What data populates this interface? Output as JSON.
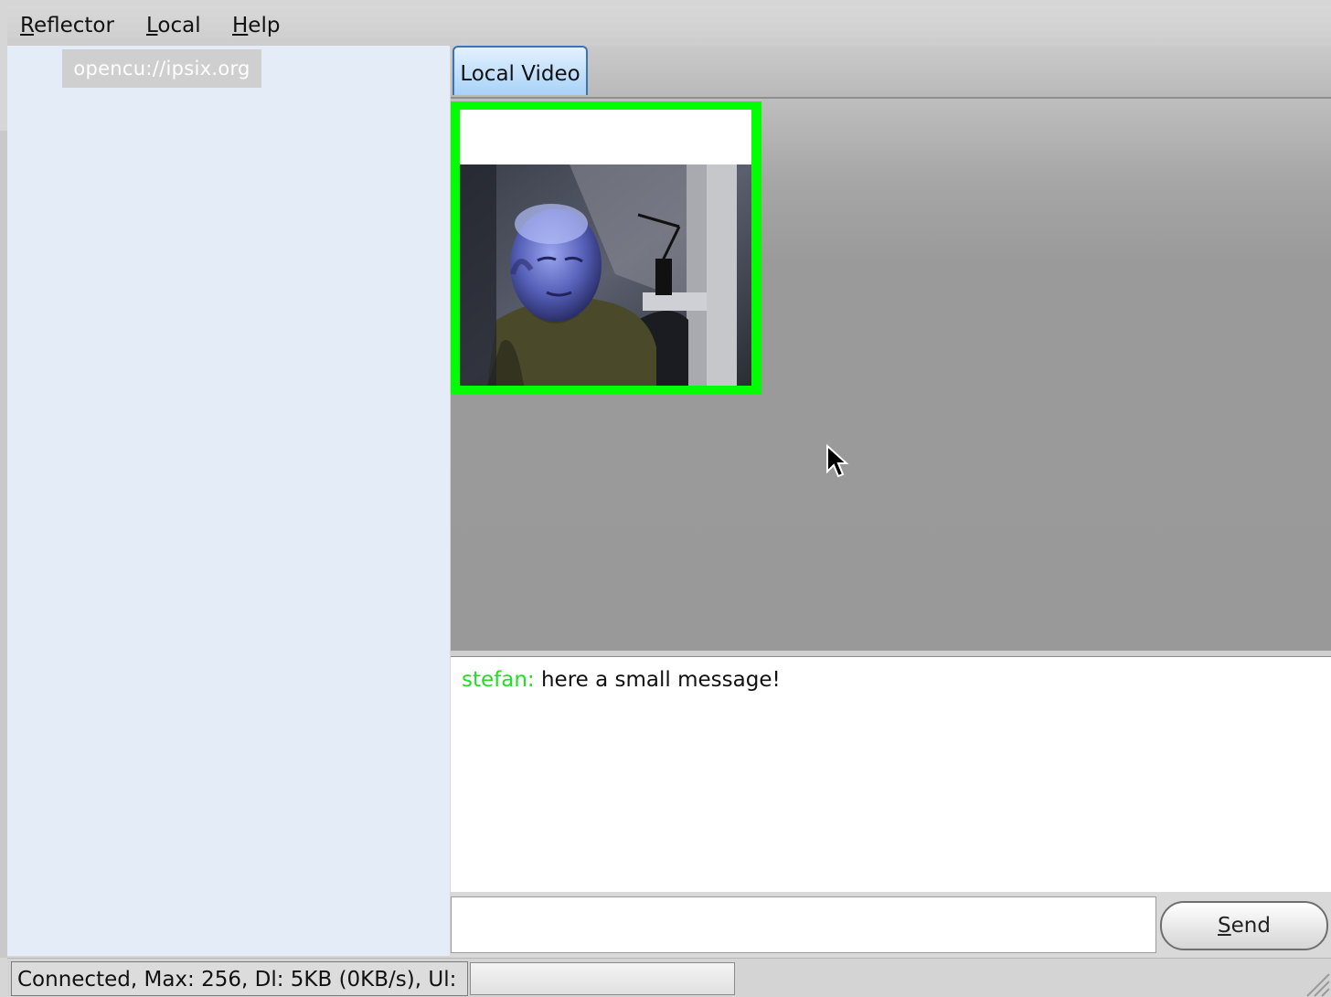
{
  "menubar": {
    "items": [
      {
        "mnemonic": "R",
        "rest": "eflector"
      },
      {
        "mnemonic": "L",
        "rest": "ocal"
      },
      {
        "mnemonic": "H",
        "rest": "elp"
      }
    ]
  },
  "sidebar": {
    "items": [
      {
        "label": "opencu://ipsix.org"
      }
    ]
  },
  "tabs": [
    {
      "label": "Local Video",
      "active": true
    }
  ],
  "video": {
    "tile_border_color": "#00ff00",
    "subject": "webcam-person"
  },
  "chat": {
    "messages": [
      {
        "sender": "stefan:",
        "text": " here a small message!",
        "sender_color": "#22dd22"
      }
    ]
  },
  "input": {
    "value": "",
    "send_mnemonic": "S",
    "send_rest": "end"
  },
  "status": {
    "text": "Connected, Max: 256, Dl: 5KB  (0KB/s), Ul: ",
    "progress": 0
  },
  "colors": {
    "sidebar_bg": "#e4ecf7",
    "tab_active": "#a8d2f7",
    "video_bg": "#999999",
    "accent_green": "#00ff00"
  }
}
